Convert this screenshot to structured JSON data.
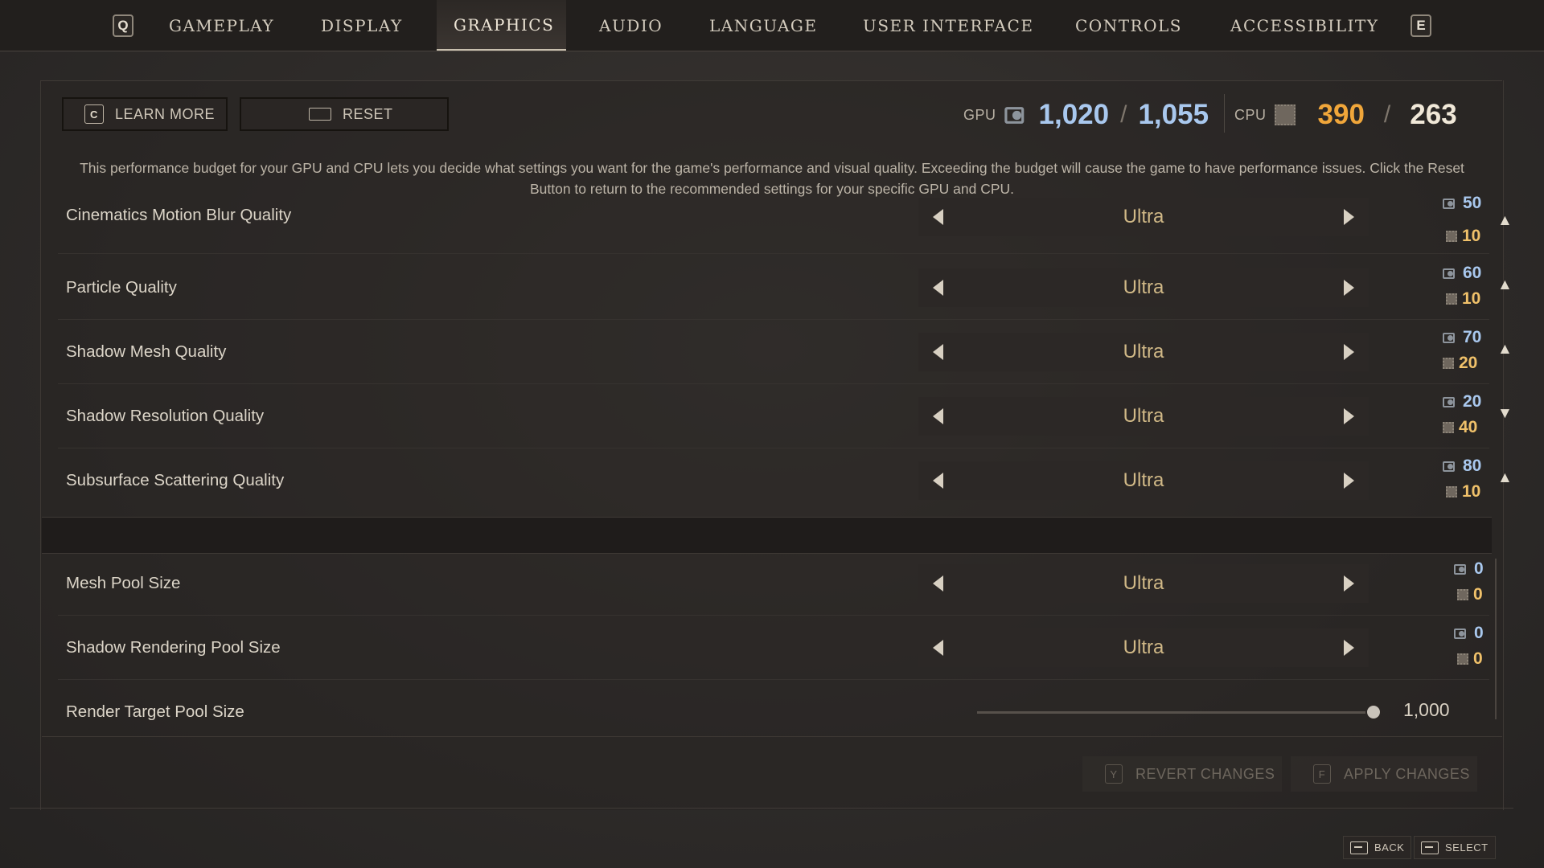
{
  "nav": {
    "prev_key": "Q",
    "next_key": "E",
    "tabs": [
      {
        "label": "GAMEPLAY"
      },
      {
        "label": "DISPLAY"
      },
      {
        "label": "GRAPHICS"
      },
      {
        "label": "AUDIO"
      },
      {
        "label": "LANGUAGE"
      },
      {
        "label": "USER INTERFACE"
      },
      {
        "label": "CONTROLS"
      },
      {
        "label": "ACCESSIBILITY"
      }
    ],
    "active_tab": "GRAPHICS"
  },
  "toolbar": {
    "learn_more_key": "C",
    "learn_more_label": "LEARN MORE",
    "reset_label": "RESET"
  },
  "budget": {
    "gpu_label": "GPU",
    "gpu_used": "1,020",
    "gpu_max": "1,055",
    "cpu_label": "CPU",
    "cpu_used": "390",
    "cpu_max": "263",
    "gpu_color": "#a9c8ee",
    "cpu_used_color": "#f0a63a",
    "cpu_max_color": "#f0e8d8"
  },
  "description": "This performance budget for your GPU and CPU lets you decide what settings you want for the game's performance and visual quality. Exceeding the budget will cause the game to have performance issues. Click the Reset Button to return to the recommended settings for your specific GPU and CPU.",
  "settings": [
    {
      "name": "Cinematics Motion Blur Quality",
      "value": "Ultra",
      "gpu": "50",
      "cpu": "10",
      "trend": "up"
    },
    {
      "name": "Particle Quality",
      "value": "Ultra",
      "gpu": "60",
      "cpu": "10",
      "trend": "up"
    },
    {
      "name": "Shadow Mesh Quality",
      "value": "Ultra",
      "gpu": "70",
      "cpu": "20",
      "trend": "up"
    },
    {
      "name": "Shadow Resolution Quality",
      "value": "Ultra",
      "gpu": "20",
      "cpu": "40",
      "trend": "down"
    },
    {
      "name": "Subsurface Scattering Quality",
      "value": "Ultra",
      "gpu": "80",
      "cpu": "10",
      "trend": "up"
    }
  ],
  "pool_settings": [
    {
      "name": "Mesh Pool Size",
      "value": "Ultra",
      "gpu": "0",
      "cpu": "0"
    },
    {
      "name": "Shadow Rendering Pool Size",
      "value": "Ultra",
      "gpu": "0",
      "cpu": "0"
    }
  ],
  "render_target": {
    "name": "Render Target Pool Size",
    "value": "1,000",
    "fraction": 1.0
  },
  "actions": {
    "revert_key": "Y",
    "revert_label": "REVERT CHANGES",
    "apply_key": "F",
    "apply_label": "APPLY CHANGES"
  },
  "hints": {
    "back_label": "BACK",
    "select_label": "SELECT"
  },
  "colors": {
    "gpu_cost": "#a9c8ee",
    "cpu_cost": "#f0c16a",
    "value_text": "#d1b987"
  }
}
